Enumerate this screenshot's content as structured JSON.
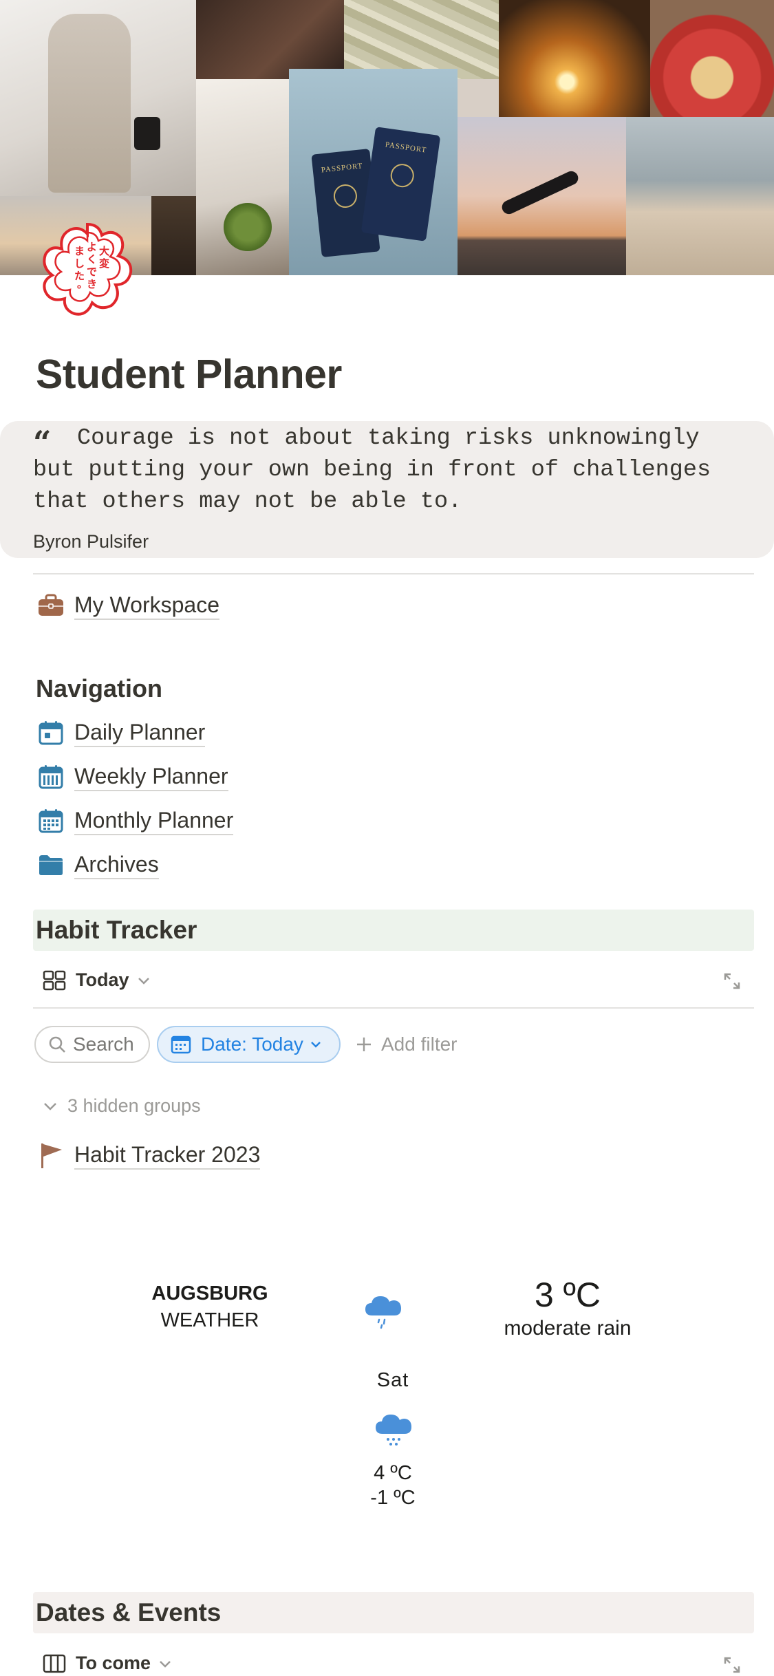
{
  "page": {
    "title": "Student Planner"
  },
  "quote": {
    "text": "Courage is not about taking risks unknowingly\nbut putting your own being in front of challenges\nthat others may not be able to.",
    "author": "Byron Pulsifer"
  },
  "cover": {
    "passport_label": "PASSPORT",
    "stamp_text": "大変よくできました。",
    "stamp_color": "#e0262b"
  },
  "workspace": {
    "label": "My Workspace",
    "icon": "briefcase-icon"
  },
  "navigation": {
    "heading": "Navigation",
    "items": [
      {
        "label": "Daily Planner",
        "icon": "calendar-day-icon"
      },
      {
        "label": "Weekly Planner",
        "icon": "calendar-week-icon"
      },
      {
        "label": "Monthly Planner",
        "icon": "calendar-month-icon"
      },
      {
        "label": "Archives",
        "icon": "folder-icon"
      }
    ]
  },
  "habit_tracker": {
    "heading": "Habit Tracker",
    "band_color": "#edf3ec",
    "view_label": "Today",
    "search_label": "Search",
    "filter_label": "Date: Today",
    "add_filter_label": "Add filter",
    "hidden_groups_label": "3 hidden groups",
    "item_label": "Habit Tracker 2023",
    "item_icon": "flag-icon"
  },
  "weather": {
    "city": "AUGSBURG",
    "label": "WEATHER",
    "current_temp": "3 ºC",
    "condition": "moderate rain",
    "forecast_day": "Sat",
    "forecast_high": "4 ºC",
    "forecast_low": "-1 ºC",
    "icon": "rain-cloud-icon",
    "icon_color": "#4a90d9"
  },
  "dates_events": {
    "heading": "Dates & Events",
    "band_color": "#f4f0ee",
    "view_label": "To come"
  },
  "colors": {
    "text": "#37352f",
    "accent_blue": "#2383e2",
    "nav_icon_blue": "#337ea9",
    "workspace_icon_brown": "#a0674a",
    "flag_brown": "#9f6b53"
  }
}
